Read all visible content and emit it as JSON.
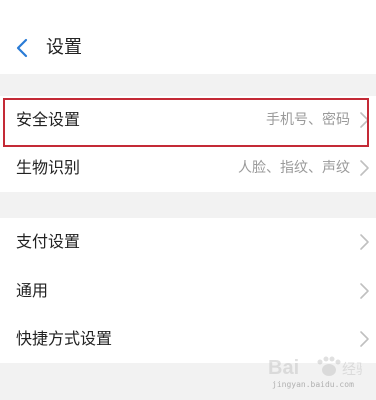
{
  "header": {
    "title": "设置",
    "back_icon": "chevron-left-icon",
    "accent_color": "#2a7bd6"
  },
  "group1": {
    "items": [
      {
        "label": "安全设置",
        "value": "手机号、密码",
        "icon": "chevron-right-icon",
        "highlighted": true
      },
      {
        "label": "生物识别",
        "value": "人脸、指纹、声纹",
        "icon": "chevron-right-icon"
      }
    ]
  },
  "group2": {
    "items": [
      {
        "label": "支付设置",
        "icon": "chevron-right-icon"
      },
      {
        "label": "通用",
        "icon": "chevron-right-icon"
      },
      {
        "label": "快捷方式设置",
        "icon": "chevron-right-icon"
      }
    ]
  },
  "highlight_color": "#c42a36",
  "watermark": {
    "text": "jingyan.baidu.com"
  }
}
